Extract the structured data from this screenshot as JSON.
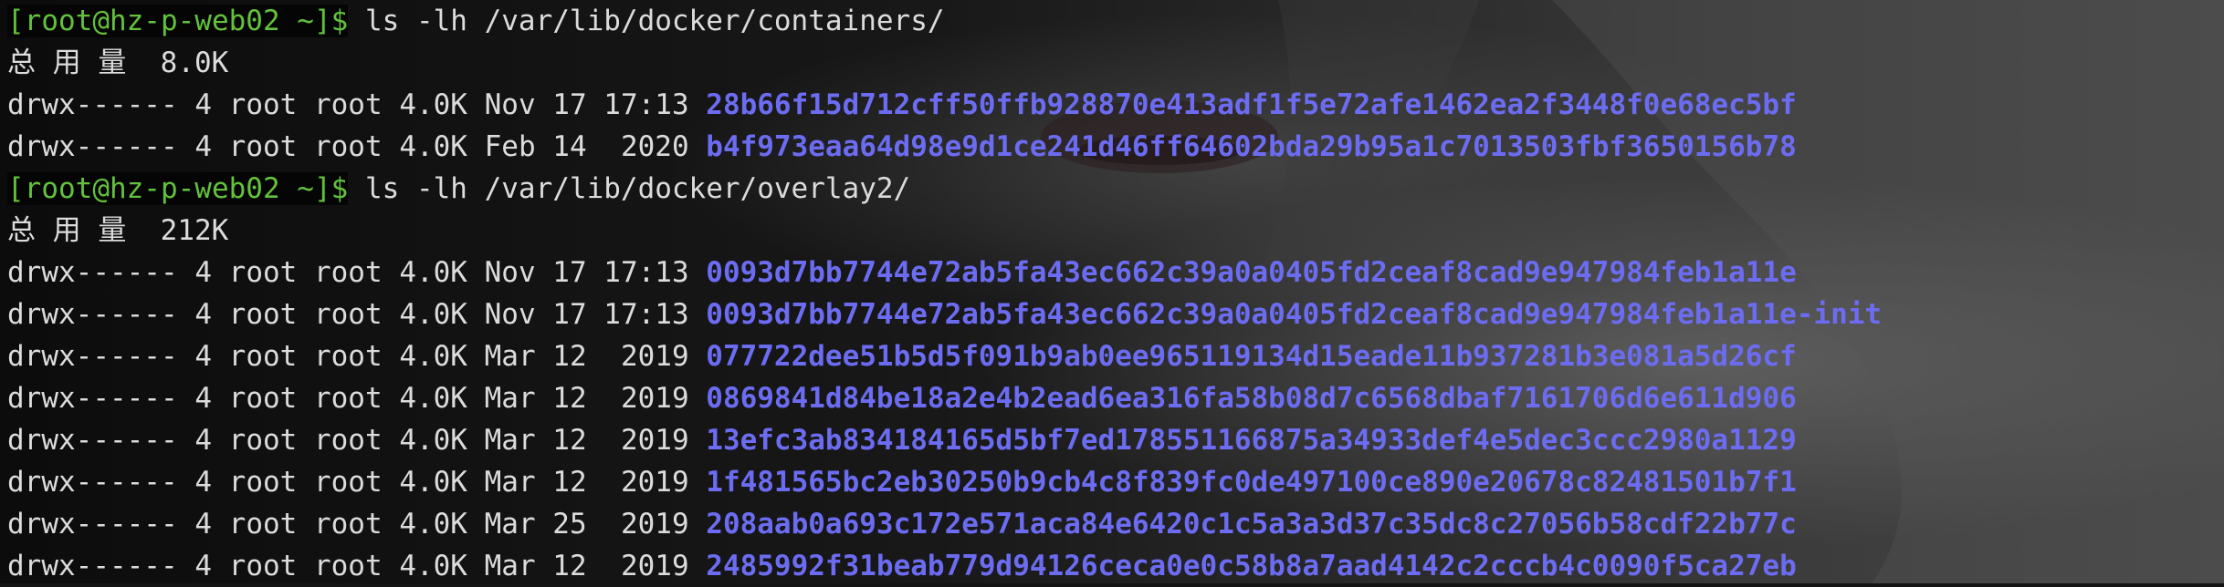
{
  "terminal": {
    "blocks": [
      {
        "prompt": "[root@hz-p-web02 ~]$",
        "command": "ls -lh /var/lib/docker/containers/",
        "total": "总 用 量  8.0K",
        "entries": [
          {
            "perm": "drwx------",
            "links": "4",
            "owner": "root",
            "group": "root",
            "size": "4.0K",
            "date": "Nov 17 17:13",
            "name": "28b66f15d712cff50ffb928870e413adf1f5e72afe1462ea2f3448f0e68ec5bf"
          },
          {
            "perm": "drwx------",
            "links": "4",
            "owner": "root",
            "group": "root",
            "size": "4.0K",
            "date": "Feb 14  2020",
            "name": "b4f973eaa64d98e9d1ce241d46ff64602bda29b95a1c7013503fbf3650156b78"
          }
        ]
      },
      {
        "prompt": "[root@hz-p-web02 ~]$",
        "command": "ls -lh /var/lib/docker/overlay2/",
        "total": "总 用 量  212K",
        "entries": [
          {
            "perm": "drwx------",
            "links": "4",
            "owner": "root",
            "group": "root",
            "size": "4.0K",
            "date": "Nov 17 17:13",
            "name": "0093d7bb7744e72ab5fa43ec662c39a0a0405fd2ceaf8cad9e947984feb1a11e"
          },
          {
            "perm": "drwx------",
            "links": "4",
            "owner": "root",
            "group": "root",
            "size": "4.0K",
            "date": "Nov 17 17:13",
            "name": "0093d7bb7744e72ab5fa43ec662c39a0a0405fd2ceaf8cad9e947984feb1a11e-init"
          },
          {
            "perm": "drwx------",
            "links": "4",
            "owner": "root",
            "group": "root",
            "size": "4.0K",
            "date": "Mar 12  2019",
            "name": "077722dee51b5d5f091b9ab0ee965119134d15eade11b937281b3e081a5d26cf"
          },
          {
            "perm": "drwx------",
            "links": "4",
            "owner": "root",
            "group": "root",
            "size": "4.0K",
            "date": "Mar 12  2019",
            "name": "0869841d84be18a2e4b2ead6ea316fa58b08d7c6568dbaf7161706d6e611d906"
          },
          {
            "perm": "drwx------",
            "links": "4",
            "owner": "root",
            "group": "root",
            "size": "4.0K",
            "date": "Mar 12  2019",
            "name": "13efc3ab834184165d5bf7ed178551166875a34933def4e5dec3ccc2980a1129"
          },
          {
            "perm": "drwx------",
            "links": "4",
            "owner": "root",
            "group": "root",
            "size": "4.0K",
            "date": "Mar 12  2019",
            "name": "1f481565bc2eb30250b9cb4c8f839fc0de497100ce890e20678c82481501b7f1"
          },
          {
            "perm": "drwx------",
            "links": "4",
            "owner": "root",
            "group": "root",
            "size": "4.0K",
            "date": "Mar 25  2019",
            "name": "208aab0a693c172e571aca84e6420c1c5a3a3d37c35dc8c27056b58cdf22b77c"
          },
          {
            "perm": "drwx------",
            "links": "4",
            "owner": "root",
            "group": "root",
            "size": "4.0K",
            "date": "Mar 12  2019",
            "name": "2485992f31beab779d94126ceca0e0c58b8a7aad4142c2cccb4c0090f5ca27eb"
          }
        ]
      }
    ]
  },
  "colors": {
    "prompt_text": "#63c23c",
    "prompt_background": "#050505",
    "output_text": "#dcdcdc",
    "directory_name": "#6c6cf2"
  }
}
